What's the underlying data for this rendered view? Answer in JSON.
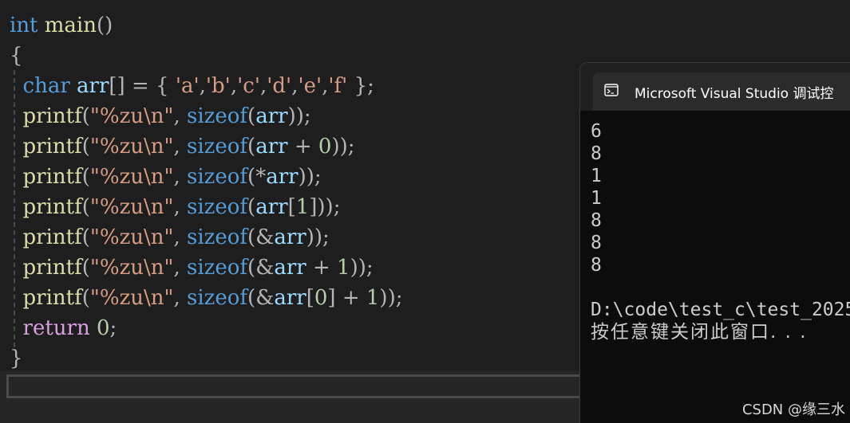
{
  "editor": {
    "lines": [
      [
        [
          "kw",
          "int"
        ],
        [
          "plain",
          " "
        ],
        [
          "fn",
          "main"
        ],
        [
          "pun",
          "()"
        ]
      ],
      [
        [
          "pun",
          "{"
        ]
      ],
      [
        [
          "plain",
          "  "
        ],
        [
          "kw",
          "char"
        ],
        [
          "plain",
          " "
        ],
        [
          "id",
          "arr"
        ],
        [
          "pun",
          "[] = { "
        ],
        [
          "str",
          "'a'"
        ],
        [
          "pun",
          ","
        ],
        [
          "str",
          "'b'"
        ],
        [
          "pun",
          ","
        ],
        [
          "str",
          "'c'"
        ],
        [
          "pun",
          ","
        ],
        [
          "str",
          "'d'"
        ],
        [
          "pun",
          ","
        ],
        [
          "str",
          "'e'"
        ],
        [
          "pun",
          ","
        ],
        [
          "str",
          "'f'"
        ],
        [
          "pun",
          " };"
        ]
      ],
      [
        [
          "plain",
          "  "
        ],
        [
          "fn",
          "printf"
        ],
        [
          "pun",
          "("
        ],
        [
          "str",
          "\"%zu\\n\""
        ],
        [
          "pun",
          ", "
        ],
        [
          "kw",
          "sizeof"
        ],
        [
          "pun",
          "("
        ],
        [
          "id",
          "arr"
        ],
        [
          "pun",
          "));"
        ]
      ],
      [
        [
          "plain",
          "  "
        ],
        [
          "fn",
          "printf"
        ],
        [
          "pun",
          "("
        ],
        [
          "str",
          "\"%zu\\n\""
        ],
        [
          "pun",
          ", "
        ],
        [
          "kw",
          "sizeof"
        ],
        [
          "pun",
          "("
        ],
        [
          "id",
          "arr"
        ],
        [
          "pun",
          " + "
        ],
        [
          "num",
          "0"
        ],
        [
          "pun",
          "));"
        ]
      ],
      [
        [
          "plain",
          "  "
        ],
        [
          "fn",
          "printf"
        ],
        [
          "pun",
          "("
        ],
        [
          "str",
          "\"%zu\\n\""
        ],
        [
          "pun",
          ", "
        ],
        [
          "kw",
          "sizeof"
        ],
        [
          "pun",
          "(*"
        ],
        [
          "id",
          "arr"
        ],
        [
          "pun",
          "));"
        ]
      ],
      [
        [
          "plain",
          "  "
        ],
        [
          "fn",
          "printf"
        ],
        [
          "pun",
          "("
        ],
        [
          "str",
          "\"%zu\\n\""
        ],
        [
          "pun",
          ", "
        ],
        [
          "kw",
          "sizeof"
        ],
        [
          "pun",
          "("
        ],
        [
          "id",
          "arr"
        ],
        [
          "pun",
          "["
        ],
        [
          "num",
          "1"
        ],
        [
          "pun",
          "]));"
        ]
      ],
      [
        [
          "plain",
          "  "
        ],
        [
          "fn",
          "printf"
        ],
        [
          "pun",
          "("
        ],
        [
          "str",
          "\"%zu\\n\""
        ],
        [
          "pun",
          ", "
        ],
        [
          "kw",
          "sizeof"
        ],
        [
          "pun",
          "(&"
        ],
        [
          "id",
          "arr"
        ],
        [
          "pun",
          "));"
        ]
      ],
      [
        [
          "plain",
          "  "
        ],
        [
          "fn",
          "printf"
        ],
        [
          "pun",
          "("
        ],
        [
          "str",
          "\"%zu\\n\""
        ],
        [
          "pun",
          ", "
        ],
        [
          "kw",
          "sizeof"
        ],
        [
          "pun",
          "(&"
        ],
        [
          "id",
          "arr"
        ],
        [
          "pun",
          " + "
        ],
        [
          "num",
          "1"
        ],
        [
          "pun",
          "));"
        ]
      ],
      [
        [
          "plain",
          "  "
        ],
        [
          "fn",
          "printf"
        ],
        [
          "pun",
          "("
        ],
        [
          "str",
          "\"%zu\\n\""
        ],
        [
          "pun",
          ", "
        ],
        [
          "kw",
          "sizeof"
        ],
        [
          "pun",
          "(&"
        ],
        [
          "id",
          "arr"
        ],
        [
          "pun",
          "["
        ],
        [
          "num",
          "0"
        ],
        [
          "pun",
          "] + "
        ],
        [
          "num",
          "1"
        ],
        [
          "pun",
          "));"
        ]
      ],
      [
        [
          "plain",
          "  "
        ],
        [
          "ret",
          "return"
        ],
        [
          "plain",
          " "
        ],
        [
          "num",
          "0"
        ],
        [
          "pun",
          ";"
        ]
      ],
      [
        [
          "pun",
          "}"
        ]
      ]
    ]
  },
  "console": {
    "title": "Microsoft Visual Studio 调试控",
    "tab_close": "×",
    "icon": "terminal-icon",
    "output": [
      "6",
      "8",
      "1",
      "1",
      "8",
      "8",
      "8"
    ],
    "blank": "",
    "path": "D:\\code\\test_c\\test_2025",
    "prompt": "按任意键关闭此窗口. . ."
  },
  "watermark": "CSDN @缘三水",
  "colors": {
    "editor_bg": "#1e1e1e",
    "keyword": "#569cd6",
    "function": "#dcdcaa",
    "string": "#d69d85",
    "identifier": "#9cdcfe",
    "number": "#b5cea8",
    "control": "#d8a0df",
    "console_bg": "#0c0c0c"
  }
}
